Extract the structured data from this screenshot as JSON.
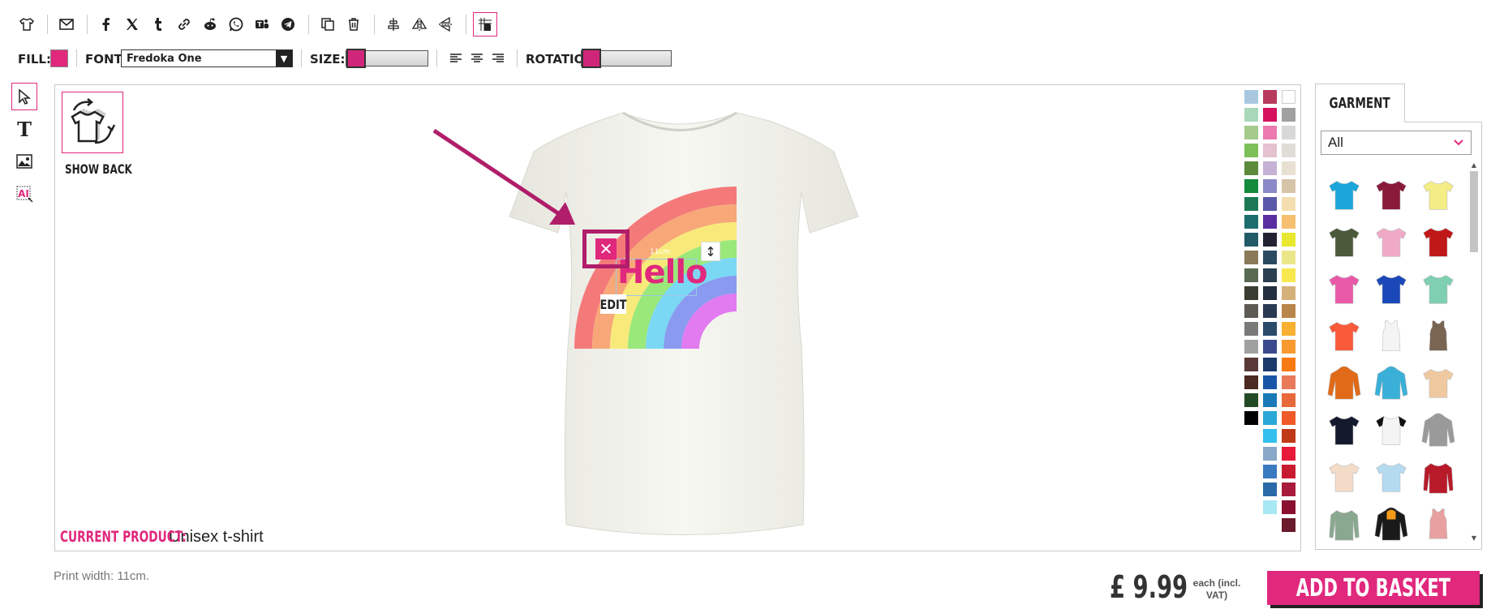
{
  "toolbar": {
    "buttons": [
      {
        "icon": "tshirt-icon"
      },
      {
        "icon": "email-icon"
      },
      {
        "icon": "facebook-icon"
      },
      {
        "icon": "x-twitter-icon"
      },
      {
        "icon": "tumblr-icon"
      },
      {
        "icon": "link-icon"
      },
      {
        "icon": "reddit-icon"
      },
      {
        "icon": "whatsapp-icon"
      },
      {
        "icon": "teams-icon"
      },
      {
        "icon": "telegram-icon"
      },
      {
        "icon": "duplicate-icon"
      },
      {
        "icon": "trash-icon"
      },
      {
        "icon": "align-center-icon"
      },
      {
        "icon": "flip-horizontal-icon"
      },
      {
        "icon": "flip-vertical-icon"
      },
      {
        "icon": "snap-grid-icon"
      }
    ]
  },
  "properties": {
    "fill_label": "FILL:",
    "fill_color": "#e0287d",
    "font_label": "FONT:",
    "font_value": "Fredoka One",
    "size_label": "SIZE:",
    "rotation_label": "ROTATION:",
    "size_level": 0,
    "rotation_level": 0
  },
  "left_tools": [
    {
      "icon": "pointer-icon"
    },
    {
      "icon": "text-icon"
    },
    {
      "icon": "image-icon"
    },
    {
      "icon": "ai-icon"
    }
  ],
  "canvas": {
    "show_back_label": "SHOW BACK",
    "text_object": "Hello",
    "dimension_label": "11cm",
    "edit_label": "EDIT",
    "current_product_label": "CURRENT PRODUCT:",
    "current_product_value": "Unisex t-shirt",
    "delete_symbol": "✕",
    "resize_symbol": "↕"
  },
  "palette": {
    "col1": [
      "#a9c8e0",
      "#a8d8b8",
      "#a4cb8c",
      "#7cc057",
      "#5a8a3a",
      "#138a3c",
      "#1b7a55",
      "#1c6e6e",
      "#215a66",
      "#8a7a5a",
      "#5a6a52",
      "#3a3d32",
      "#5e5b55",
      "#7a7a7a",
      "#a0a0a0",
      "#5a3a38",
      "#4a2a22",
      "#234a24",
      "#000000"
    ],
    "col2": [
      "#b83a5c",
      "#d4125e",
      "#ea7ab0",
      "#e4c2d0",
      "#c6b2d6",
      "#8a8ac8",
      "#5a58a8",
      "#5a2ea0",
      "#222232",
      "#2a4a62",
      "#2a4050",
      "#243040",
      "#2a3a52",
      "#2a4a6a",
      "#3a4a8c",
      "#1a3a6a",
      "#1a56a8",
      "#1a7ab8",
      "#2aa8d8",
      "#34c0ee",
      "#8aa8c8",
      "#3a7ac0",
      "#2a6aa8",
      "#a8e8f4"
    ],
    "col3": [
      "#ffffff",
      "#a0a0a0",
      "#d8d8d8",
      "#e0dcd8",
      "#e8e0d2",
      "#d6c4a8",
      "#f4deb0",
      "#f6c070",
      "#e8e830",
      "#ece68a",
      "#f8e850",
      "#d4b07a",
      "#b8864a",
      "#f8b030",
      "#f89a30",
      "#f87a12",
      "#e87a5a",
      "#e86a3a",
      "#f05a28",
      "#c03a18",
      "#e81a3a",
      "#c81a30",
      "#a81a3a",
      "#8a1030",
      "#6a1a2a"
    ]
  },
  "garment": {
    "tab_label": "GARMENT",
    "filter_value": "All",
    "items": [
      {
        "name": "cyan-tshirt",
        "color": "#1aa6d8",
        "shape": "tee"
      },
      {
        "name": "maroon-tshirt",
        "color": "#8a1a3a",
        "shape": "tee"
      },
      {
        "name": "yellow-tshirt",
        "color": "#f4ec84",
        "shape": "tee"
      },
      {
        "name": "olive-tshirt",
        "color": "#4a5a3a",
        "shape": "tee"
      },
      {
        "name": "pink-tshirt",
        "color": "#f0aac8",
        "shape": "tee"
      },
      {
        "name": "red-tshirt",
        "color": "#c01818",
        "shape": "tee"
      },
      {
        "name": "fuchsia-tshirt",
        "color": "#e85aa8",
        "shape": "tee"
      },
      {
        "name": "royal-blue-tshirt",
        "color": "#1a48b8",
        "shape": "tee"
      },
      {
        "name": "mint-tshirt",
        "color": "#7ed0b0",
        "shape": "tee"
      },
      {
        "name": "coral-tshirt",
        "color": "#f85a3a",
        "shape": "tee"
      },
      {
        "name": "white-tank",
        "color": "#f4f4f4",
        "shape": "tank"
      },
      {
        "name": "brown-tank",
        "color": "#7a6452",
        "shape": "tank"
      },
      {
        "name": "orange-hoodie",
        "color": "#e06a18",
        "shape": "hoodie"
      },
      {
        "name": "sky-hoodie",
        "color": "#3ab0d8",
        "shape": "hoodie"
      },
      {
        "name": "tiedye-tshirt",
        "color": "#f0c8a0",
        "shape": "tee"
      },
      {
        "name": "navy-tshirt",
        "color": "#141a2e",
        "shape": "tee"
      },
      {
        "name": "baseball-tshirt",
        "color": "#f4f4f4",
        "shape": "raglan"
      },
      {
        "name": "grey-hoodie",
        "color": "#9a9a9a",
        "shape": "hoodie"
      },
      {
        "name": "beige-tshirt",
        "color": "#f2dcc8",
        "shape": "tee"
      },
      {
        "name": "light-blue-tshirt",
        "color": "#b4daf0",
        "shape": "tee"
      },
      {
        "name": "varsity-jacket",
        "color": "#b81a2a",
        "shape": "jacket"
      },
      {
        "name": "sage-longsleeve",
        "color": "#8aa890",
        "shape": "longsleeve"
      },
      {
        "name": "black-orange-hoodie",
        "color": "#1a1a1a",
        "shape": "hoodie"
      },
      {
        "name": "rose-tank",
        "color": "#e8a0a0",
        "shape": "tank"
      }
    ]
  },
  "footer": {
    "print_width": "Print width: 11cm.",
    "price": "£ 9.99",
    "price_note": "each (incl. VAT)",
    "add_to_basket": "ADD TO BASKET"
  },
  "colors": {
    "accent": "#e0287d",
    "shirt": "#f4f4ee"
  }
}
